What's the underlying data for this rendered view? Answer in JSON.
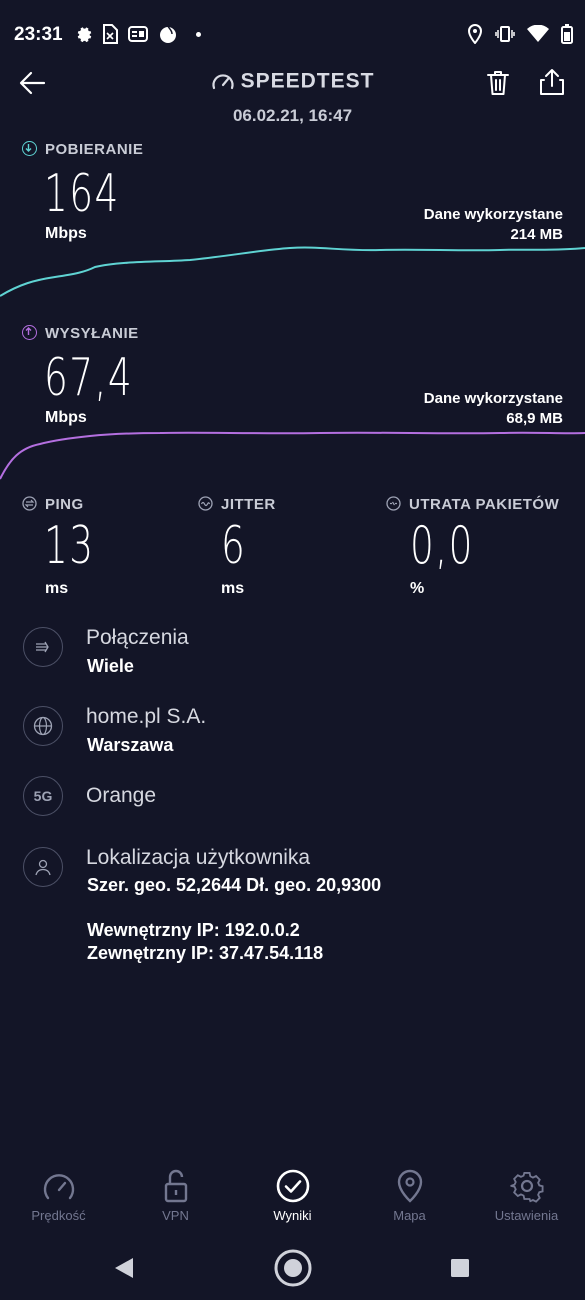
{
  "status_bar": {
    "time": "23:31"
  },
  "header": {
    "title": "SPEEDTEST",
    "date": "06.02.21, 16:47"
  },
  "download": {
    "label": "POBIERANIE",
    "value": "164",
    "unit": "Mbps",
    "data_used_label": "Dane wykorzystane",
    "data_used_value": "214 MB",
    "color": "#5fd3d3"
  },
  "upload": {
    "label": "WYSYŁANIE",
    "value": "67,4",
    "unit": "Mbps",
    "data_used_label": "Dane wykorzystane",
    "data_used_value": "68,9 MB",
    "color": "#b46fe0"
  },
  "metrics": {
    "ping": {
      "label": "PING",
      "value": "13",
      "unit": "ms"
    },
    "jitter": {
      "label": "JITTER",
      "value": "6",
      "unit": "ms"
    },
    "loss": {
      "label": "UTRATA PAKIETÓW",
      "value": "0,0",
      "unit": "%"
    }
  },
  "info": {
    "connections": {
      "title": "Połączenia",
      "sub": "Wiele"
    },
    "server": {
      "title": "home.pl S.A.",
      "sub": "Warszawa"
    },
    "provider": {
      "badge": "5G",
      "title": "Orange"
    },
    "location": {
      "title": "Lokalizacja użytkownika",
      "coords": "Szer. geo. 52,2644 Dł. geo. 20,9300",
      "internal_ip": "Wewnętrzny IP: 192.0.0.2",
      "external_ip": "Zewnętrzny IP: 37.47.54.118"
    }
  },
  "nav": {
    "speed": "Prędkość",
    "vpn": "VPN",
    "results": "Wyniki",
    "map": "Mapa",
    "settings": "Ustawienia"
  }
}
